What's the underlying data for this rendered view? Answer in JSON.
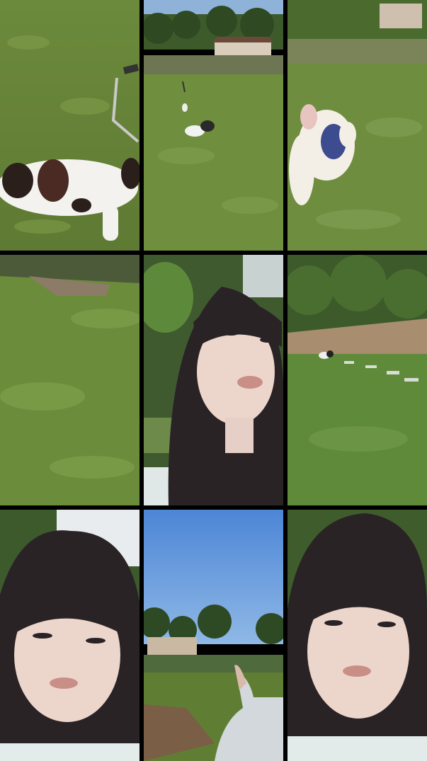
{
  "grid": {
    "rows": 3,
    "columns": 3,
    "tiles": [
      {
        "scene": "grass-with-bulldog"
      },
      {
        "scene": "lawn-two-dogs-house"
      },
      {
        "scene": "white-dog-sweater"
      },
      {
        "scene": "grass-slope-deck"
      },
      {
        "scene": "woman-looking-up"
      },
      {
        "scene": "lawn-stepping-stones-dogs"
      },
      {
        "scene": "woman-selfie"
      },
      {
        "scene": "blue-sky-village-hand"
      },
      {
        "scene": "woman-selfie-close"
      }
    ]
  },
  "colors": {
    "gutter": "#000000",
    "grass": "#6f8f3f",
    "sky": "#5a8fd6",
    "hair": "#2a2326",
    "skin": "#ecd6cc"
  }
}
